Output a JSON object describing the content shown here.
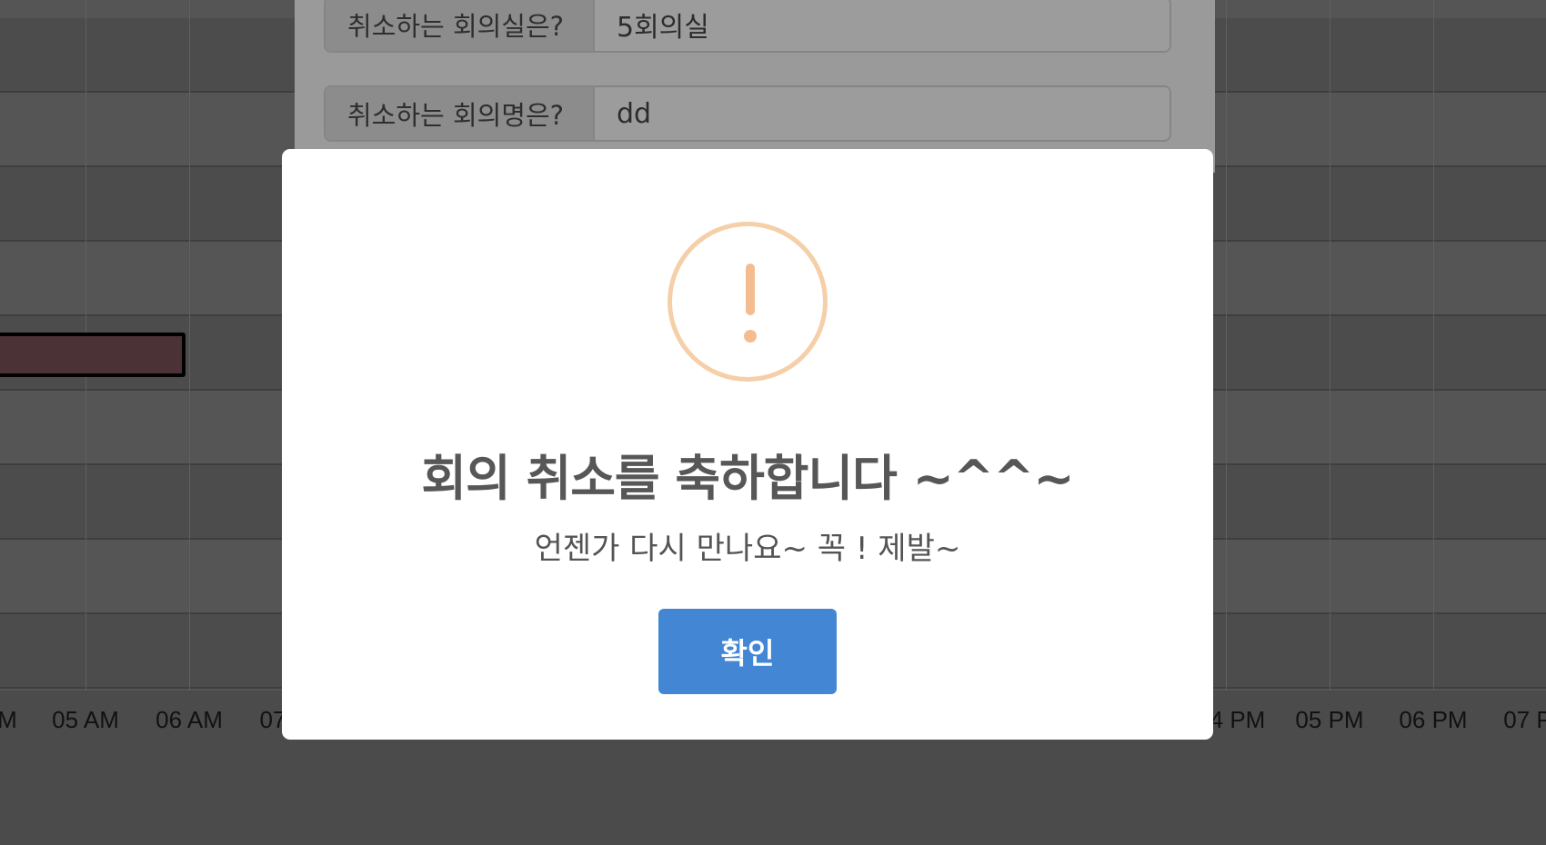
{
  "timeline": {
    "tick_labels": [
      "M",
      "05 AM",
      "06 AM",
      "07",
      "4 PM",
      "05 PM",
      "06 PM",
      "07 P"
    ]
  },
  "form": {
    "room_label": "취소하는 회의실은?",
    "room_value": "5회의실",
    "meeting_label": "취소하는 회의명은?",
    "meeting_value": "dd"
  },
  "modal": {
    "icon": "exclamation-warning-icon",
    "title": "회의 취소를 축하합니다 ~^^~",
    "text": "언젠가 다시 만나요~ 꼭 ! 제발~",
    "confirm_label": "확인"
  },
  "colors": {
    "warning_accent": "#f4bd8f",
    "confirm_button": "#4386d4",
    "booking_bar": "#4a3236"
  }
}
